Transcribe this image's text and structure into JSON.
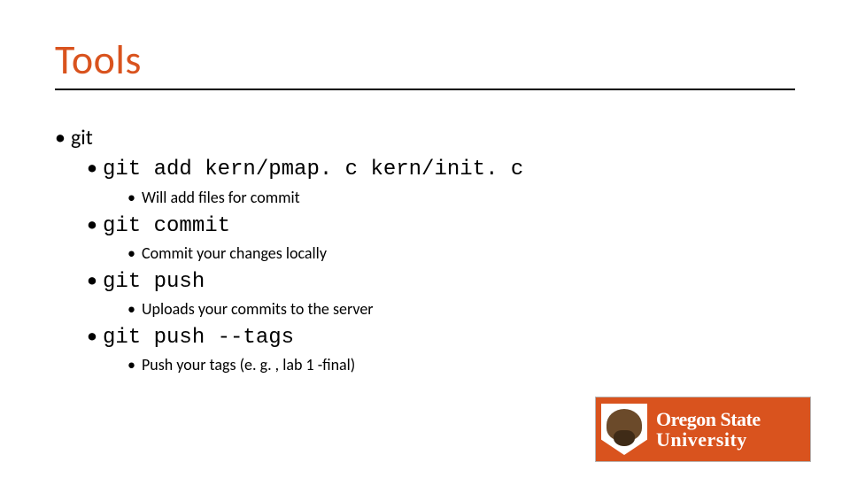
{
  "title": "Tools",
  "bullets": {
    "top": "git",
    "items": [
      {
        "cmd": "git add kern/pmap. c kern/init. c",
        "desc": "Will add files for commit"
      },
      {
        "cmd": "git commit",
        "desc": "Commit your changes locally"
      },
      {
        "cmd": "git push",
        "desc": "Uploads your commits to the server"
      },
      {
        "cmd": "git push --tags",
        "desc": "Push your tags (e. g. , lab 1 -final)"
      }
    ]
  },
  "logo": {
    "line1": "Oregon State",
    "line2": "University"
  }
}
